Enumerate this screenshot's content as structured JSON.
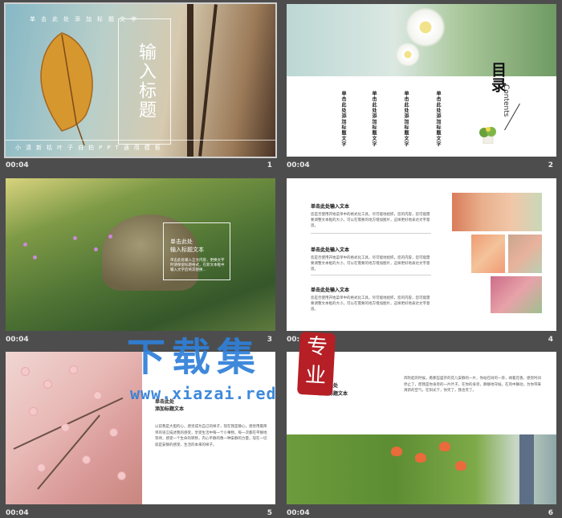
{
  "slides": [
    {
      "number": "1",
      "duration": "00:04",
      "title": "输入标题",
      "top_caption": "单击此处添加标题文字",
      "bottom_caption": "小清新枯叶子自拍PPT通用模板"
    },
    {
      "number": "2",
      "duration": "00:04",
      "heading": "目录",
      "heading_en": "Contents",
      "items": [
        "单击此处添加标题文字",
        "单击此处添加标题文字",
        "单击此处添加标题文字",
        "单击此处添加标题文字"
      ]
    },
    {
      "number": "3",
      "duration": "00:04",
      "box_title_1": "单击此处",
      "box_title_2": "输入标题文本",
      "box_text": "单击此处输入正文内容，更换文字时请保留标题格式，在新文本框中输入文字后将其替换..."
    },
    {
      "number": "4",
      "duration": "00:04",
      "items": [
        {
          "title": "单击此处输入文本",
          "text": "您是否使用开始菜单中的格式化工具，尽可能地组织，您的内容，您可能需要调整文本框的大小，可以在需要的地方增加图片，这样更好地表达文字意思。"
        },
        {
          "title": "单击此处输入文本",
          "text": "您是否使用开始菜单中的格式化工具，尽可能地组织，您的内容，您可能需要调整文本框的大小，可以在需要的地方增加图片，这样更好地表达文字意思。"
        },
        {
          "title": "单击此处输入文本",
          "text": "您是否使用开始菜单中的格式化工具，尽可能地组织，您的内容，您可能需要调整文本框的大小，可以在需要的地方增加图片，这样更好地表达文字意思。"
        }
      ]
    },
    {
      "number": "5",
      "duration": "00:04",
      "heading_1": "单击此处",
      "heading_2": "添加标题文本",
      "text": "以前我是大胆的心，感觉成为自己的样子，现在我是静心，感觉用最简单的语言描述我的感受，享受生活中每一个小事物，每一次都在平静地等待，感受一个生命的转移，内心平静的像一种安静的力量，现在一切就是安静的感受，生活的本来的样子。"
    },
    {
      "number": "6",
      "duration": "00:04",
      "heading_1": "单击此处",
      "heading_2": "添加标题文本",
      "text": "风吹起的时候，看那些盛开的花儿安静的一片，你站在树的一旁，闻着花香，感觉时间停止了，而我是你身旁的一片叶子，在你的身旁，静静地守候，在风中舞动，为你带来清新的空气，在阳光下，你笑了，我也笑了。"
    }
  ],
  "watermark": {
    "title": "下载集",
    "url": "www.xiazai.red",
    "seal": "专业"
  }
}
